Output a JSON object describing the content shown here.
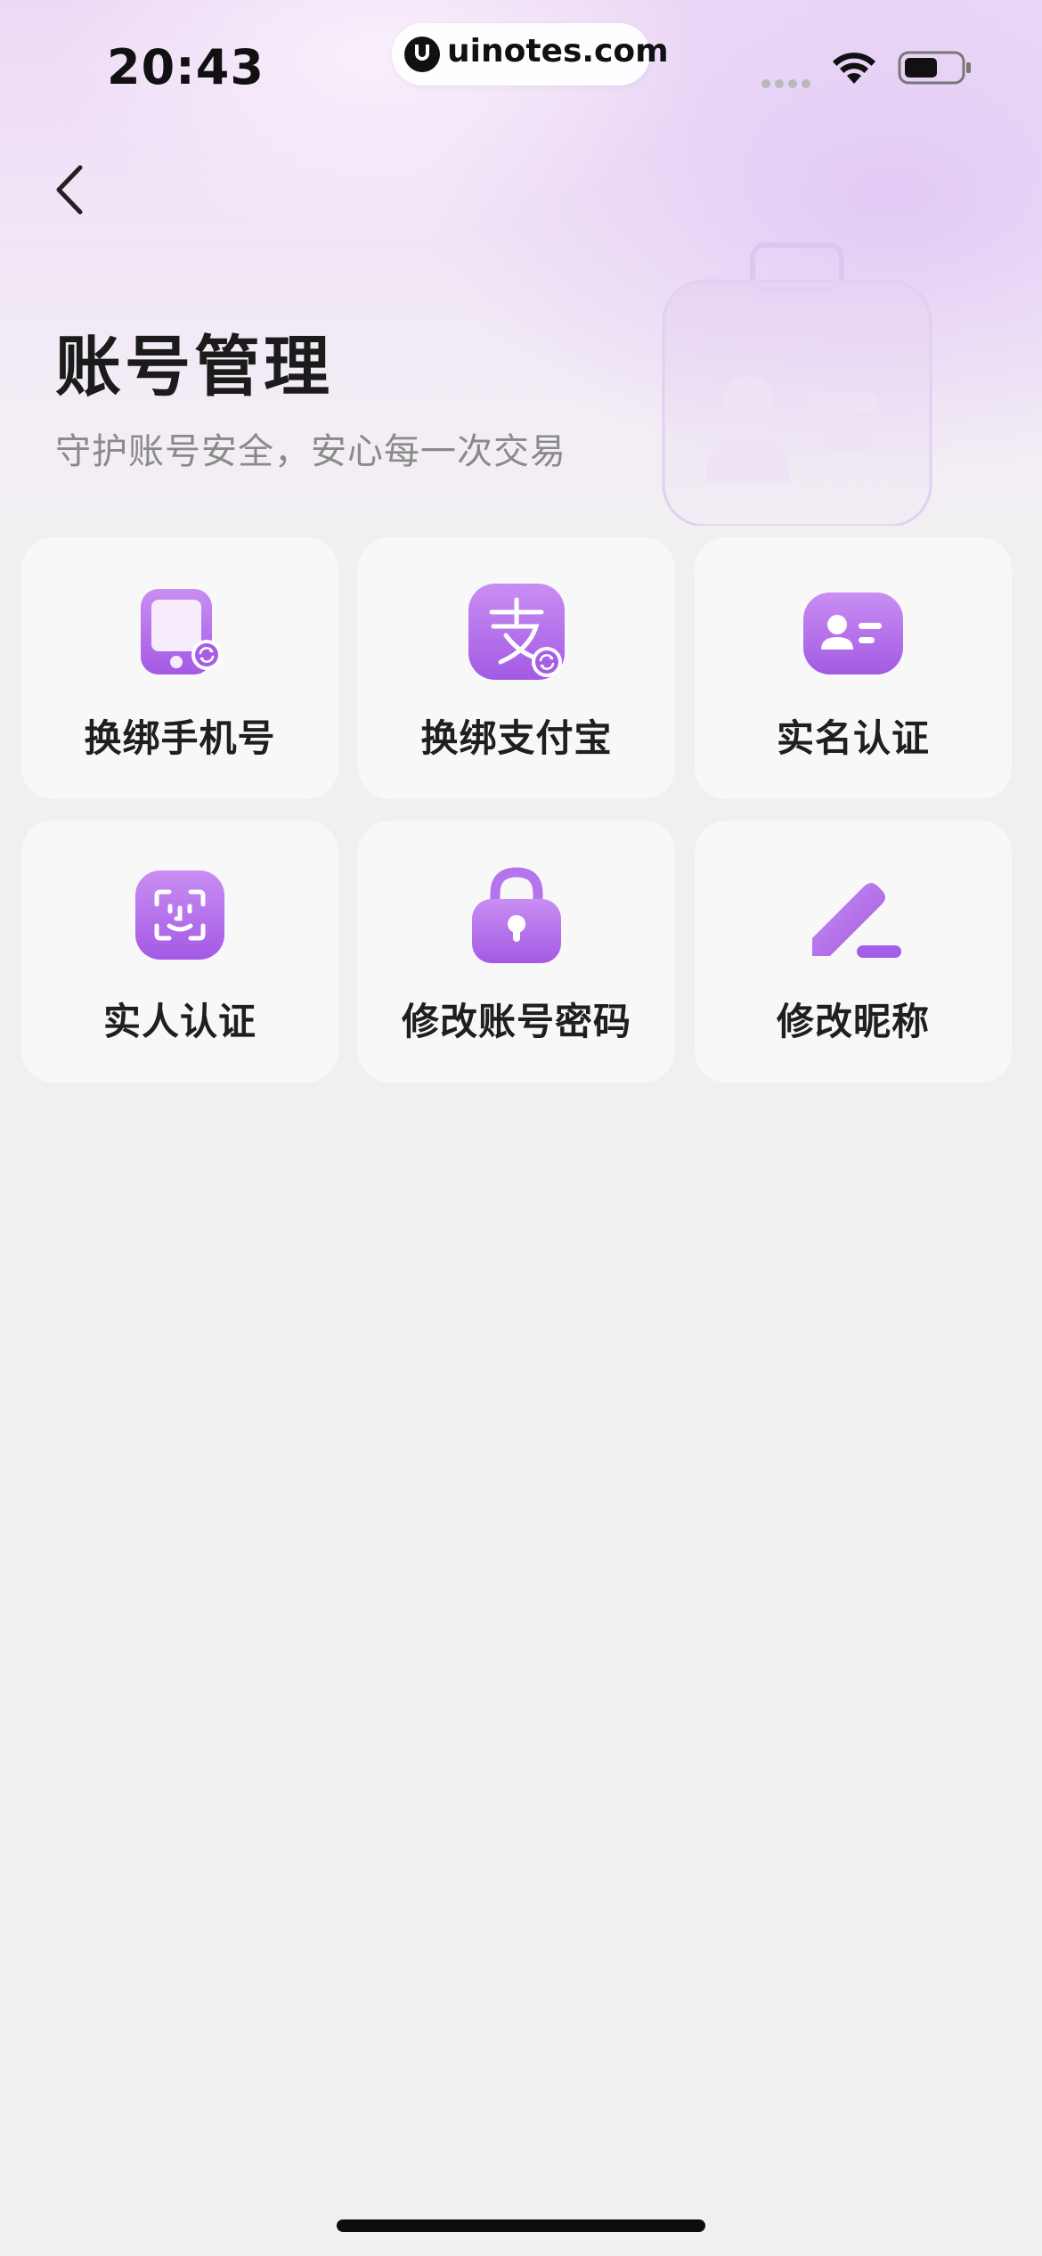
{
  "status_bar": {
    "time": "20:43",
    "site": "uinotes.com"
  },
  "header": {
    "title": "账号管理",
    "subtitle": "守护账号安全，安心每一次交易"
  },
  "menu": {
    "items": [
      {
        "label": "换绑手机号",
        "icon": "phone-swap-icon"
      },
      {
        "label": "换绑支付宝",
        "icon": "alipay-swap-icon"
      },
      {
        "label": "实名认证",
        "icon": "id-card-icon"
      },
      {
        "label": "实人认证",
        "icon": "face-scan-icon"
      },
      {
        "label": "修改账号密码",
        "icon": "lock-icon"
      },
      {
        "label": "修改昵称",
        "icon": "pencil-icon"
      }
    ]
  },
  "colors": {
    "accent": "#a55ee6",
    "accent_light": "#c88cf1",
    "card_bg": "#f8f8f8",
    "page_bg": "#f0f0f0"
  }
}
